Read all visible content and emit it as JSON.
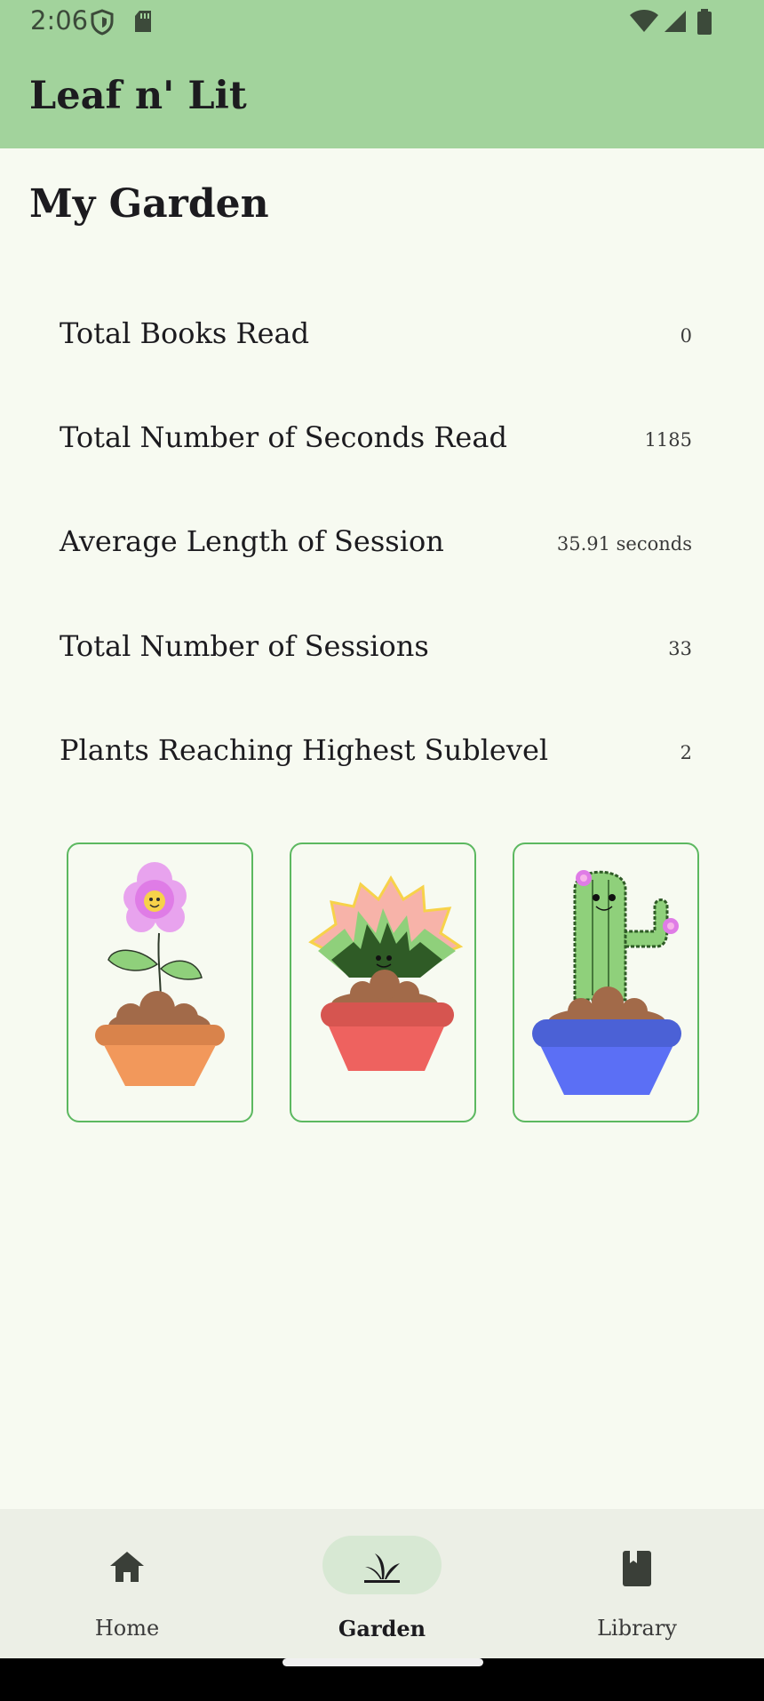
{
  "status_bar": {
    "time": "2:06",
    "icons": [
      "shield-icon",
      "sd-card-icon",
      "wifi-icon",
      "signal-icon",
      "battery-icon"
    ]
  },
  "app_bar": {
    "title": "Leaf n' Lit"
  },
  "page": {
    "title": "My Garden"
  },
  "stats": [
    {
      "label": "Total Books Read",
      "value": "0"
    },
    {
      "label": "Total Number of Seconds Read",
      "value": "1185"
    },
    {
      "label": "Average Length of Session",
      "value": "35.91 seconds"
    },
    {
      "label": "Total Number of Sessions",
      "value": "33"
    },
    {
      "label": "Plants Reaching Highest Sublevel",
      "value": "2"
    }
  ],
  "plants": [
    {
      "name": "flower-plant",
      "pot_color": "#f2985b"
    },
    {
      "name": "succulent-plant",
      "pot_color": "#ee625f"
    },
    {
      "name": "cactus-plant",
      "pot_color": "#5b6ff5"
    }
  ],
  "bottom_nav": {
    "items": [
      {
        "label": "Home",
        "icon": "home-icon",
        "active": false
      },
      {
        "label": "Garden",
        "icon": "plant-icon",
        "active": true
      },
      {
        "label": "Library",
        "icon": "book-icon",
        "active": false
      }
    ]
  },
  "colors": {
    "app_bar": "#a2d39c",
    "background": "#f7faf1",
    "card_border": "#5cb860",
    "nav_background": "#ecefe6",
    "nav_active_pill": "#d7e8d3"
  }
}
